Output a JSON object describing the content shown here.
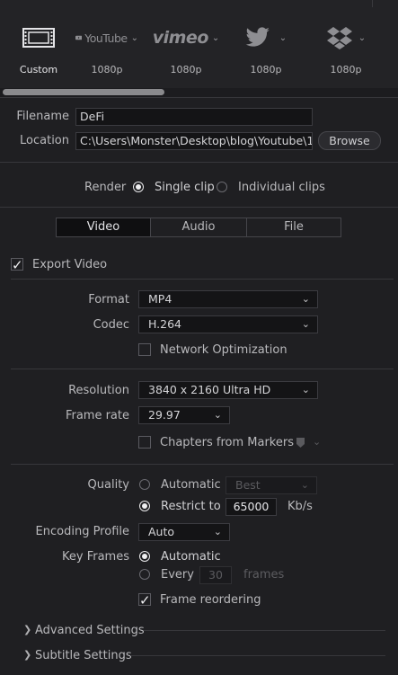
{
  "presets": [
    {
      "name": "film-strip-icon",
      "label": "Custom",
      "selected": true
    },
    {
      "name": "youtube-icon",
      "brand": "YouTube",
      "label": "1080p"
    },
    {
      "name": "vimeo-icon",
      "brand": "vimeo",
      "label": "1080p"
    },
    {
      "name": "twitter-icon",
      "brand": "",
      "label": "1080p"
    },
    {
      "name": "dropbox-icon",
      "brand": "",
      "label": "1080p"
    }
  ],
  "file": {
    "filename_label": "Filename",
    "filename_value": "DeFi",
    "location_label": "Location",
    "location_value": "C:\\Users\\Monster\\Desktop\\blog\\Youtube\\1",
    "browse_label": "Browse"
  },
  "render": {
    "label": "Render",
    "single_clip": "Single clip",
    "individual_clips": "Individual clips"
  },
  "tabs": [
    "Video",
    "Audio",
    "File"
  ],
  "export_video_label": "Export Video",
  "format": {
    "label": "Format",
    "value": "MP4"
  },
  "codec": {
    "label": "Codec",
    "value": "H.264"
  },
  "network_optimization": "Network Optimization",
  "resolution": {
    "label": "Resolution",
    "value": "3840 x 2160 Ultra HD"
  },
  "frame_rate": {
    "label": "Frame rate",
    "value": "29.97"
  },
  "chapters_label": "Chapters from Markers",
  "quality": {
    "label": "Quality",
    "automatic": "Automatic",
    "auto_value": "Best",
    "restrict_label": "Restrict to",
    "restrict_value": "65000",
    "unit": "Kb/s"
  },
  "encoding_profile": {
    "label": "Encoding Profile",
    "value": "Auto"
  },
  "key_frames": {
    "label": "Key Frames",
    "automatic": "Automatic",
    "every": "Every",
    "every_value": "30",
    "frames": "frames"
  },
  "frame_reordering": "Frame reordering",
  "advanced_settings": "Advanced Settings",
  "subtitle_settings": "Subtitle Settings"
}
